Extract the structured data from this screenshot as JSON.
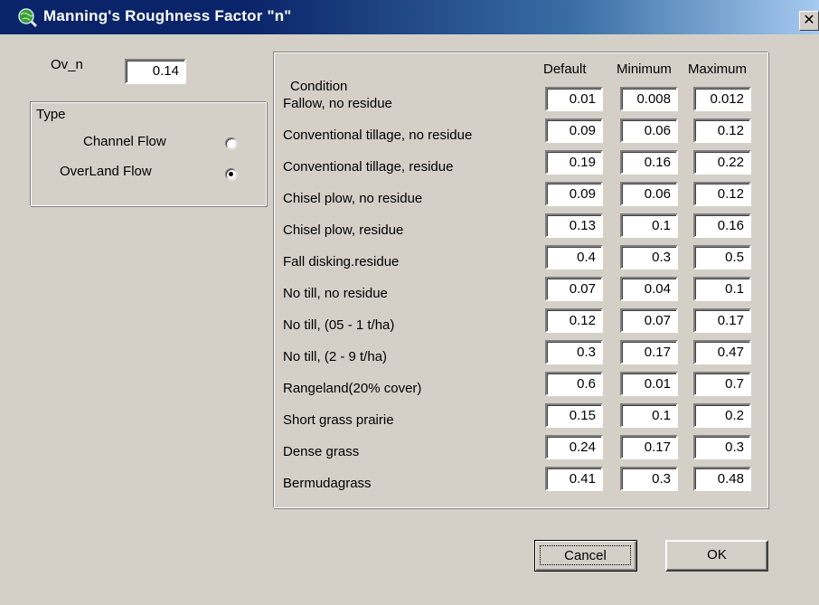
{
  "window": {
    "title": "Manning's Roughness Factor \"n\"",
    "close_label": "✕",
    "colors": {
      "titlebar": "#0a246a",
      "face": "#d4d0c8"
    }
  },
  "ovn": {
    "label": "Ov_n",
    "value": "0.14"
  },
  "type_group": {
    "legend": "Type",
    "options": [
      {
        "label": "Channel Flow",
        "selected": false
      },
      {
        "label": "OverLand Flow",
        "selected": true
      }
    ]
  },
  "table": {
    "headers": {
      "condition": "Condition",
      "default": "Default",
      "minimum": "Minimum",
      "maximum": "Maximum"
    },
    "rows": [
      {
        "condition": "Fallow, no residue",
        "default": "0.01",
        "minimum": "0.008",
        "maximum": "0.012"
      },
      {
        "condition": "Conventional tillage, no residue",
        "default": "0.09",
        "minimum": "0.06",
        "maximum": "0.12"
      },
      {
        "condition": "Conventional tillage, residue",
        "default": "0.19",
        "minimum": "0.16",
        "maximum": "0.22"
      },
      {
        "condition": "Chisel plow, no residue",
        "default": "0.09",
        "minimum": "0.06",
        "maximum": "0.12"
      },
      {
        "condition": "Chisel plow, residue",
        "default": "0.13",
        "minimum": "0.1",
        "maximum": "0.16"
      },
      {
        "condition": "Fall disking.residue",
        "default": "0.4",
        "minimum": "0.3",
        "maximum": "0.5"
      },
      {
        "condition": "No till, no residue",
        "default": "0.07",
        "minimum": "0.04",
        "maximum": "0.1"
      },
      {
        "condition": "No till, (05 - 1 t/ha)",
        "default": "0.12",
        "minimum": "0.07",
        "maximum": "0.17"
      },
      {
        "condition": "No till, (2 - 9 t/ha)",
        "default": "0.3",
        "minimum": "0.17",
        "maximum": "0.47"
      },
      {
        "condition": "Rangeland(20% cover)",
        "default": "0.6",
        "minimum": "0.01",
        "maximum": "0.7"
      },
      {
        "condition": "Short grass prairie",
        "default": "0.15",
        "minimum": "0.1",
        "maximum": "0.2"
      },
      {
        "condition": "Dense grass",
        "default": "0.24",
        "minimum": "0.17",
        "maximum": "0.3"
      },
      {
        "condition": "Bermudagrass",
        "default": "0.41",
        "minimum": "0.3",
        "maximum": "0.48"
      }
    ]
  },
  "buttons": {
    "cancel": "Cancel",
    "ok": "OK"
  }
}
